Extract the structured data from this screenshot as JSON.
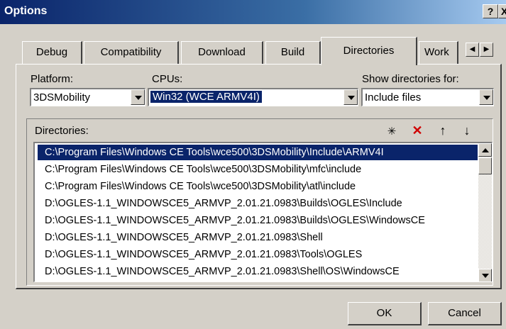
{
  "window": {
    "title": "Options",
    "help_label": "?",
    "close_label": "X"
  },
  "tabs": [
    {
      "label": "Debug"
    },
    {
      "label": "Compatibility"
    },
    {
      "label": "Download"
    },
    {
      "label": "Build"
    },
    {
      "label": "Directories"
    },
    {
      "label": "Work"
    }
  ],
  "active_tab": "Directories",
  "platform": {
    "label": "Platform:",
    "value": "3DSMobility"
  },
  "cpus": {
    "label": "CPUs:",
    "value": "Win32 (WCE ARMV4I)"
  },
  "show_for": {
    "label": "Show directories for:",
    "value": "Include files"
  },
  "directories": {
    "label": "Directories:",
    "items": [
      "C:\\Program Files\\Windows CE Tools\\wce500\\3DSMobility\\Include\\ARMV4I",
      "C:\\Program Files\\Windows CE Tools\\wce500\\3DSMobility\\mfc\\include",
      "C:\\Program Files\\Windows CE Tools\\wce500\\3DSMobility\\atl\\include",
      "D:\\OGLES-1.1_WINDOWSCE5_ARMVP_2.01.21.0983\\Builds\\OGLES\\Include",
      "D:\\OGLES-1.1_WINDOWSCE5_ARMVP_2.01.21.0983\\Builds\\OGLES\\WindowsCE",
      "D:\\OGLES-1.1_WINDOWSCE5_ARMVP_2.01.21.0983\\Shell",
      "D:\\OGLES-1.1_WINDOWSCE5_ARMVP_2.01.21.0983\\Tools\\OGLES",
      "D:\\OGLES-1.1_WINDOWSCE5_ARMVP_2.01.21.0983\\Shell\\OS\\WindowsCE"
    ],
    "selected_index": 0
  },
  "buttons": {
    "ok": "OK",
    "cancel": "Cancel"
  },
  "colors": {
    "title_start": "#0a246a",
    "face": "#d4d0c8",
    "selection": "#0a246a",
    "delete_red": "#d00000"
  }
}
